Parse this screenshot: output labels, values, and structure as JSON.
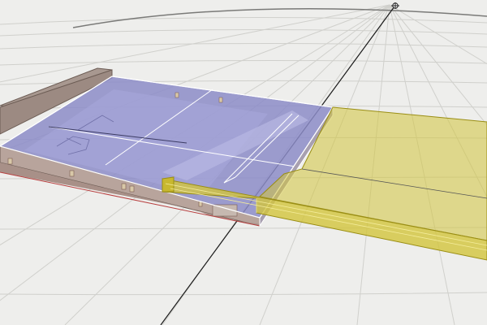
{
  "viewport": {
    "background_color": "#eeeeec",
    "grid_color": "#d0d0cc",
    "horizon_color": "#7a7a78",
    "axis_color": "#1a1a1a"
  },
  "model": {
    "building_roof_color": "#8c8cc8",
    "building_wall_color": "#b09c94",
    "selection_color": "#d2c43c",
    "selection_edge_color": "#9a8e14"
  },
  "icons": {
    "compass": "compass-icon"
  }
}
